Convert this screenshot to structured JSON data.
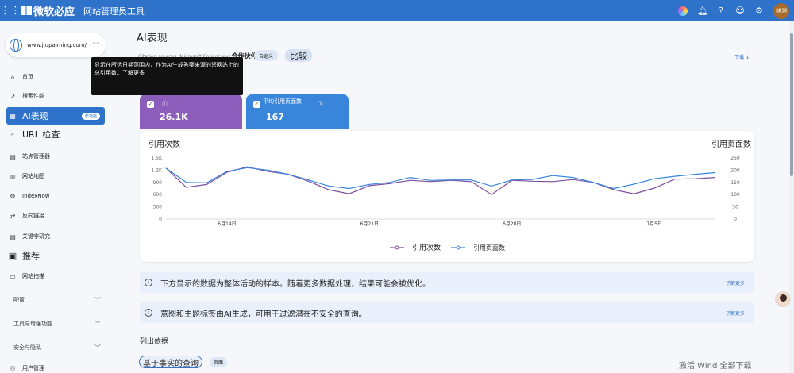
{
  "topbar": {
    "brand": "微软必应",
    "product": "网站管理员工具",
    "avatar_text": "林测"
  },
  "site": {
    "url": "www.jiupaiming.com/"
  },
  "sidebar": {
    "items": [
      {
        "label": "首页",
        "icon": "home-icon"
      },
      {
        "label": "搜索性能",
        "icon": "trend-icon"
      },
      {
        "label": "AI表现",
        "icon": "ai-icon",
        "badge": "新功能"
      },
      {
        "label": "URL 检查",
        "icon": "search-icon"
      },
      {
        "label": "站点管理器",
        "icon": "doc-icon"
      },
      {
        "label": "网站地图",
        "icon": "sitemap-icon"
      },
      {
        "label": "IndexNow",
        "icon": "gear-icon"
      },
      {
        "label": "反向链接",
        "icon": "link-icon"
      },
      {
        "label": "关键字研究",
        "icon": "doc-icon"
      },
      {
        "label": "推荐",
        "icon": "recommend-icon"
      },
      {
        "label": "网站扫描",
        "icon": "scan-icon"
      }
    ],
    "groups": [
      {
        "label": "配置"
      },
      {
        "label": "工具与增强功能"
      },
      {
        "label": "安全与隐私"
      }
    ],
    "user_mgmt": "用户管理"
  },
  "main": {
    "title": "AI表现",
    "subtitle_faint": "Citation sources: Microsoft Copilot and",
    "subtitle_bold": "合作伙伴",
    "filters": {
      "custom": "自定义",
      "compare": "比较"
    },
    "download": "下载 ↓",
    "tooltip": "显示在所选日期范围内，作为AI生成答案来源的您网站上的总引用数。了解更多",
    "cards": [
      {
        "label": "",
        "value": "26.1K"
      },
      {
        "label": "平均引用页面数",
        "value": "167"
      }
    ],
    "banners": [
      {
        "text": "下方显示的数据为整体活动的样本。随着更多数据处理，结果可能会被优化。",
        "more": "了解更多"
      },
      {
        "text": "意图和主题标签由AI生成，可用于过滤潜在不安全的查询。",
        "more": "了解更多"
      }
    ],
    "section_label": "列出依据",
    "tabs": {
      "factual": "基于事实的查询",
      "page": "页面"
    },
    "activate": "激活 Wind 全部下载"
  },
  "chart_data": {
    "type": "line",
    "left_axis_label": "引用次数",
    "right_axis_label": "引用页面数",
    "left_ticks": [
      "1.5K",
      "1.2K",
      "900",
      "600",
      "300",
      "0"
    ],
    "right_ticks": [
      "250",
      "200",
      "150",
      "100",
      "50",
      "0"
    ],
    "ylim_left": [
      0,
      1500
    ],
    "ylim_right": [
      0,
      250
    ],
    "x_ticks": [
      {
        "label": "6月14日",
        "index": 3
      },
      {
        "label": "6月21日",
        "index": 10
      },
      {
        "label": "6月28日",
        "index": 17
      },
      {
        "label": "7月5日",
        "index": 24
      }
    ],
    "series": [
      {
        "name": "引用次数",
        "axis": "left",
        "color": "#7b4e9e",
        "values": [
          1250,
          780,
          850,
          1150,
          1280,
          1170,
          1100,
          930,
          720,
          620,
          820,
          870,
          950,
          920,
          950,
          920,
          600,
          950,
          930,
          920,
          970,
          900,
          720,
          620,
          760,
          980,
          990,
          1020
        ]
      },
      {
        "name": "引用页面数",
        "axis": "right",
        "color": "#3a85dc",
        "values": [
          208,
          150,
          148,
          195,
          210,
          200,
          183,
          160,
          135,
          125,
          142,
          150,
          170,
          158,
          160,
          160,
          135,
          160,
          162,
          178,
          170,
          150,
          125,
          143,
          165,
          175,
          183,
          190
        ]
      }
    ]
  }
}
